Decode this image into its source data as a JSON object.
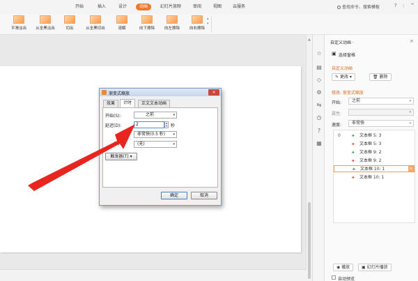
{
  "menu": {
    "items": [
      "开始",
      "插入",
      "设计",
      "动画",
      "幻灯片放映",
      "审阅",
      "视图",
      "云服务"
    ],
    "active": "动画",
    "search": "查找命令、搜索模板",
    "help_icon": "?",
    "more_icon": ":",
    "collapse_icon": "^"
  },
  "ribbon": {
    "effects": [
      "平滑淡出",
      "从全黑淡出",
      "切出",
      "从全黑切出",
      "溶解",
      "向下擦除",
      "向左擦除",
      "向右擦除"
    ]
  },
  "pane": {
    "title": "自定义动画 ·",
    "select_pane_label": "选择窗格",
    "section_title": "自定义动画",
    "change_btn": "更改",
    "delete_btn": "删除",
    "modify_label": "修改: 渐变式缩放",
    "start_label": "开始:",
    "start_value": "之前",
    "property_label": "属性:",
    "speed_label": "速度:",
    "speed_value": "非常快",
    "list_index": "0",
    "animations": [
      "文本框 5: 3",
      "文本框 5: 3",
      "文本框 9: 2",
      "文本框 9: 2",
      "文本框 10: 1",
      "文本框 10: 1"
    ],
    "play_btn": "播放",
    "slideshow_btn": "幻灯片播放",
    "autopreview_label": "自动预览"
  },
  "dialog": {
    "title": "渐变式缩放",
    "close": "×",
    "tabs": [
      "效果",
      "计时",
      "正文文本动画"
    ],
    "active_tab": "计时",
    "start_label": "开始(S):",
    "start_value": "之前",
    "delay_label": "延迟(D):",
    "delay_value": "2",
    "delay_unit": "秒",
    "speed_value": "非常快(0.5 秒)",
    "repeat_label": "(R):",
    "repeat_value": "(无)",
    "trigger_btn": "触发器(T) ▾",
    "ok_btn": "确定",
    "cancel_btn": "取消"
  },
  "colors": {
    "accent": "#f0782a",
    "arrow": "#e8261f"
  }
}
